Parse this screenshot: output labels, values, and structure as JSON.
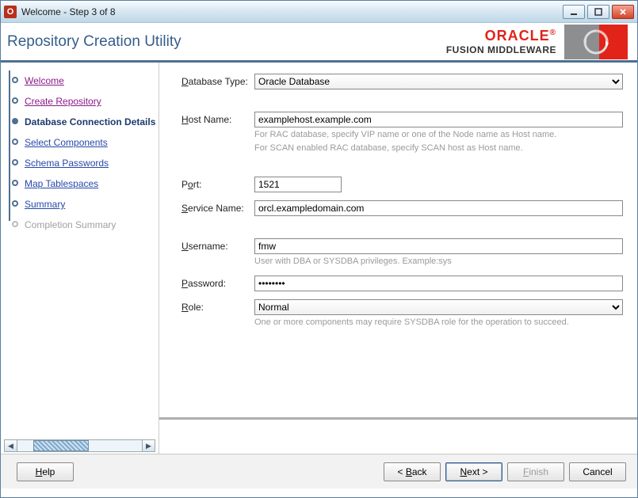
{
  "window": {
    "title": "Welcome - Step 3 of 8"
  },
  "header": {
    "title": "Repository Creation Utility",
    "brand_top": "ORACLE",
    "brand_bottom": "FUSION MIDDLEWARE"
  },
  "sidebar": {
    "steps": [
      {
        "label": "Welcome",
        "state": "visited"
      },
      {
        "label": "Create Repository",
        "state": "visited"
      },
      {
        "label": "Database Connection Details",
        "state": "current"
      },
      {
        "label": "Select Components",
        "state": "link"
      },
      {
        "label": "Schema Passwords",
        "state": "link"
      },
      {
        "label": "Map Tablespaces",
        "state": "link"
      },
      {
        "label": "Summary",
        "state": "link"
      },
      {
        "label": "Completion Summary",
        "state": "disabled"
      }
    ]
  },
  "form": {
    "database_type": {
      "label": "Database Type:",
      "value": "Oracle Database"
    },
    "host_name": {
      "label": "Host Name:",
      "value": "examplehost.example.com",
      "hint1": "For RAC database, specify VIP name or one of the Node name as Host name.",
      "hint2": "For SCAN enabled RAC database, specify SCAN host as Host name."
    },
    "port": {
      "label": "Port:",
      "value": "1521"
    },
    "service_name": {
      "label": "Service Name:",
      "value": "orcl.exampledomain.com"
    },
    "username": {
      "label": "Username:",
      "value": "fmw",
      "hint": "User with DBA or SYSDBA privileges. Example:sys"
    },
    "password": {
      "label": "Password:",
      "value": "••••••••"
    },
    "role": {
      "label": "Role:",
      "value": "Normal",
      "hint": "One or more components may require SYSDBA role for the operation to succeed."
    }
  },
  "footer": {
    "help": "Help",
    "back": "< Back",
    "next": "Next >",
    "finish": "Finish",
    "cancel": "Cancel"
  }
}
